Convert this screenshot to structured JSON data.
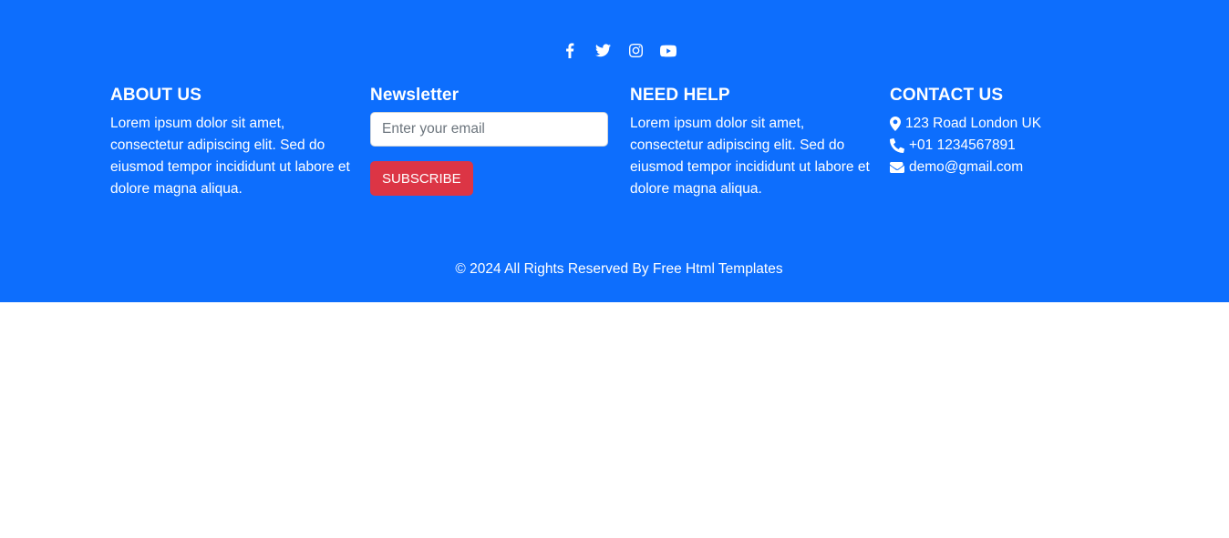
{
  "colors": {
    "footer_bg": "#0d6efd",
    "subscribe_bg": "#dc3545",
    "text": "#ffffff"
  },
  "social": [
    {
      "name": "facebook-icon"
    },
    {
      "name": "twitter-icon"
    },
    {
      "name": "instagram-icon"
    },
    {
      "name": "youtube-icon"
    }
  ],
  "about": {
    "heading": "ABOUT US",
    "text": "Lorem ipsum dolor sit amet, consectetur adipiscing elit. Sed do eiusmod tempor incididunt ut labore et dolore magna aliqua."
  },
  "newsletter": {
    "heading": "Newsletter",
    "placeholder": "Enter your email",
    "value": "",
    "button_label": "SUBSCRIBE"
  },
  "help": {
    "heading": "NEED HELP",
    "text": "Lorem ipsum dolor sit amet, consectetur adipiscing elit. Sed do eiusmod tempor incididunt ut labore et dolore magna aliqua."
  },
  "contact": {
    "heading": "CONTACT US",
    "address": "123 Road London UK",
    "phone": "+01 1234567891",
    "email": "demo@gmail.com"
  },
  "copyright": "© 2024 All Rights Reserved By Free Html Templates"
}
